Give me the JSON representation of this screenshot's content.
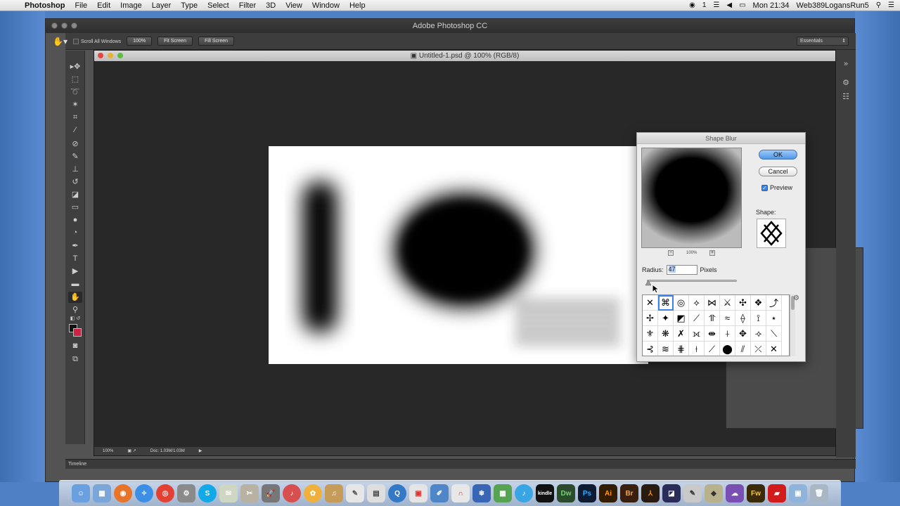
{
  "menubar": {
    "apple": "",
    "app_name": "Photoshop",
    "items": [
      "File",
      "Edit",
      "Image",
      "Layer",
      "Type",
      "Select",
      "Filter",
      "3D",
      "View",
      "Window",
      "Help"
    ],
    "status_count": "1",
    "clock": "Mon 21:34",
    "user": "Web389LogansRun5"
  },
  "app": {
    "title": "Adobe Photoshop CC",
    "options": {
      "scroll_all_windows": "Scroll All Windows",
      "zoom_100": "100%",
      "fit_screen": "Fit Screen",
      "fill_screen": "Fill Screen",
      "workspace": "Essentials"
    }
  },
  "document": {
    "tab_title": "Untitled-1.psd @ 100% (RGB/8)",
    "status_zoom": "100%",
    "doc_size": "Doc: 1.03M/1.03M"
  },
  "timeline": {
    "label": "Timeline"
  },
  "dialog": {
    "title": "Shape Blur",
    "ok": "OK",
    "cancel": "Cancel",
    "preview_label": "Preview",
    "preview_checked": true,
    "zoom_minus": "−",
    "zoom_plus": "+",
    "zoom_level": "100%",
    "shape_label": "Shape:",
    "radius_label": "Radius:",
    "radius_value": "47",
    "radius_unit": "Pixels"
  },
  "colors": {
    "foreground": "#111111",
    "background": "#cc2244",
    "accent": "#3b83e8"
  },
  "dock": {
    "ai_label": "Ai",
    "br_label": "Br",
    "dw_label": "Dw",
    "ps_label": "Ps",
    "fw_label": "Fw",
    "kindle_label": "kindle"
  }
}
